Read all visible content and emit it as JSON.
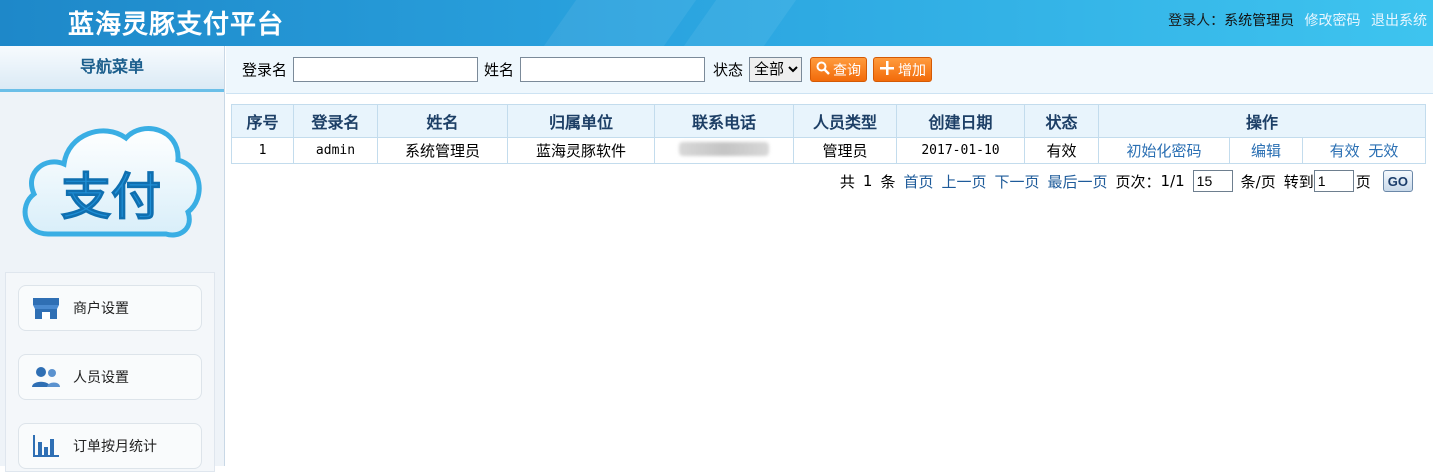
{
  "header": {
    "title": "蓝海灵豚支付平台",
    "user_prefix": "登录人：",
    "user_name": "系统管理员",
    "change_password": "修改密码",
    "logout": "退出系统"
  },
  "sidebar": {
    "nav_title": "导航菜单",
    "logo_text": "支付",
    "items": [
      {
        "label": "商户设置",
        "icon": "store-icon"
      },
      {
        "label": "人员设置",
        "icon": "users-icon"
      },
      {
        "label": "订单按月统计",
        "icon": "bar-chart-icon"
      }
    ]
  },
  "search": {
    "login_label": "登录名",
    "login_value": "",
    "name_label": "姓名",
    "name_value": "",
    "status_label": "状态",
    "status_selected": "全部",
    "query_button": "查询",
    "add_button": "增加"
  },
  "table": {
    "headers": [
      "序号",
      "登录名",
      "姓名",
      "归属单位",
      "联系电话",
      "人员类型",
      "创建日期",
      "状态",
      "操作"
    ],
    "rows": [
      {
        "index": "1",
        "login": "admin",
        "name": "系统管理员",
        "unit": "蓝海灵豚软件",
        "phone": "",
        "type": "管理员",
        "created": "2017-01-10",
        "status": "有效",
        "action_reset": "初始化密码",
        "action_edit": "编辑",
        "action_valid": "有效",
        "action_invalid": "无效"
      }
    ]
  },
  "pager": {
    "total_prefix": "共",
    "total": "1",
    "total_suffix": "条",
    "first": "首页",
    "prev": "上一页",
    "next": "下一页",
    "last": "最后一页",
    "page_label": "页次：",
    "page_value": "1/1",
    "page_size": "15",
    "size_suffix": "条/页",
    "goto_label": "转到",
    "goto_value": "1",
    "goto_suffix": "页",
    "go_button": "GO"
  }
}
